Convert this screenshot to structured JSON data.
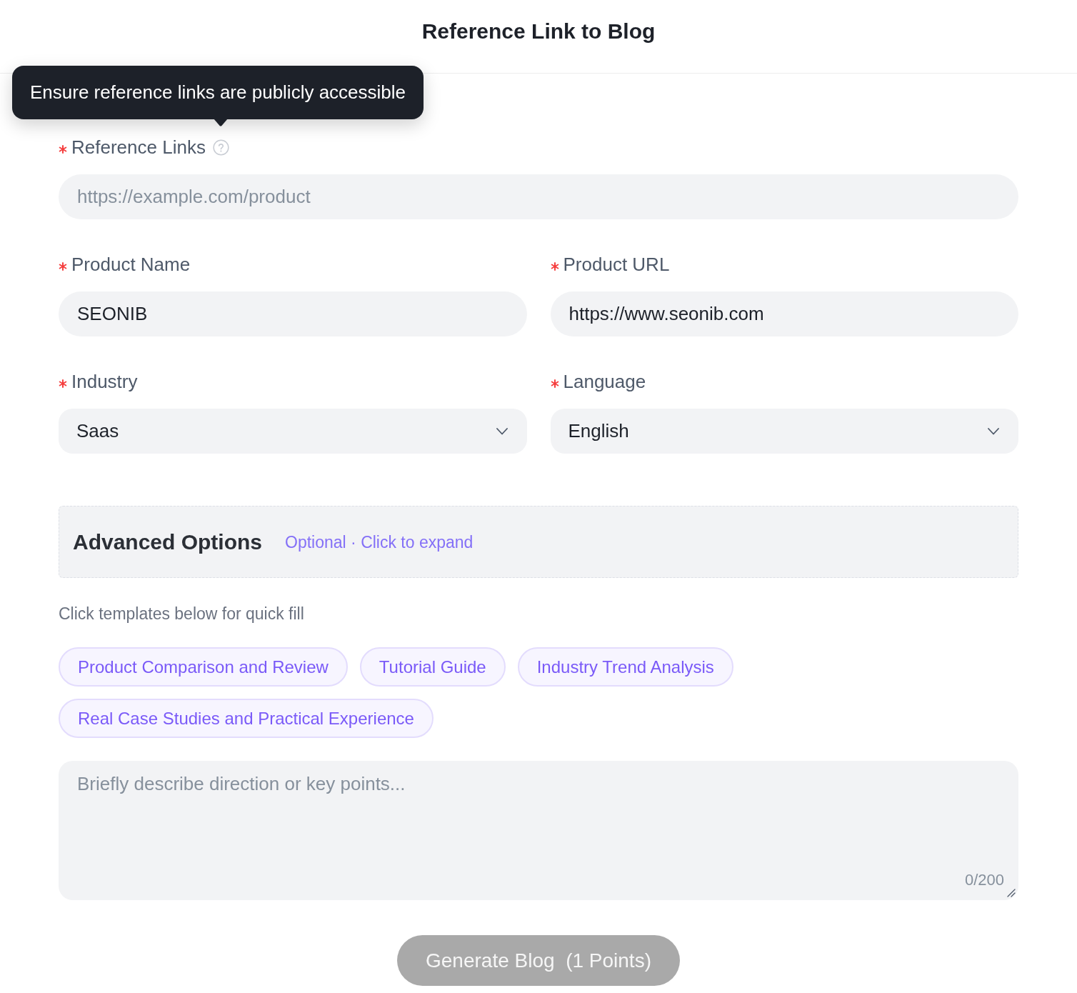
{
  "header": {
    "title": "Reference Link to Blog"
  },
  "form": {
    "rows": [
      [
        {
          "kind": "input",
          "label": "Reference Links",
          "required": true,
          "help": {
            "tooltip": "Ensure reference links are publicly accessible"
          },
          "placeholder": "https://example.com/product"
        }
      ],
      [
        {
          "kind": "input",
          "label": "Product Name",
          "required": true,
          "value": "SEONIB"
        },
        {
          "kind": "input",
          "label": "Product URL",
          "required": true,
          "value": "https://www.seonib.com"
        }
      ],
      [
        {
          "kind": "select",
          "label": "Industry",
          "required": true,
          "value": "Saas"
        },
        {
          "kind": "select",
          "label": "Language",
          "required": true,
          "value": "English"
        }
      ]
    ]
  },
  "advanced_options": {
    "title": "Advanced Options",
    "hint": "Optional · Click to expand"
  },
  "templates": {
    "hint": "Click templates below for quick fill",
    "chips": [
      "Product Comparison and Review",
      "Tutorial Guide",
      "Industry Trend Analysis",
      "Real Case Studies and Practical Experience"
    ]
  },
  "description": {
    "placeholder": "Briefly describe direction or key points...",
    "counter": "0/200"
  },
  "submit": {
    "label": "Generate Blog  (1 Points)",
    "disabled": true
  }
}
